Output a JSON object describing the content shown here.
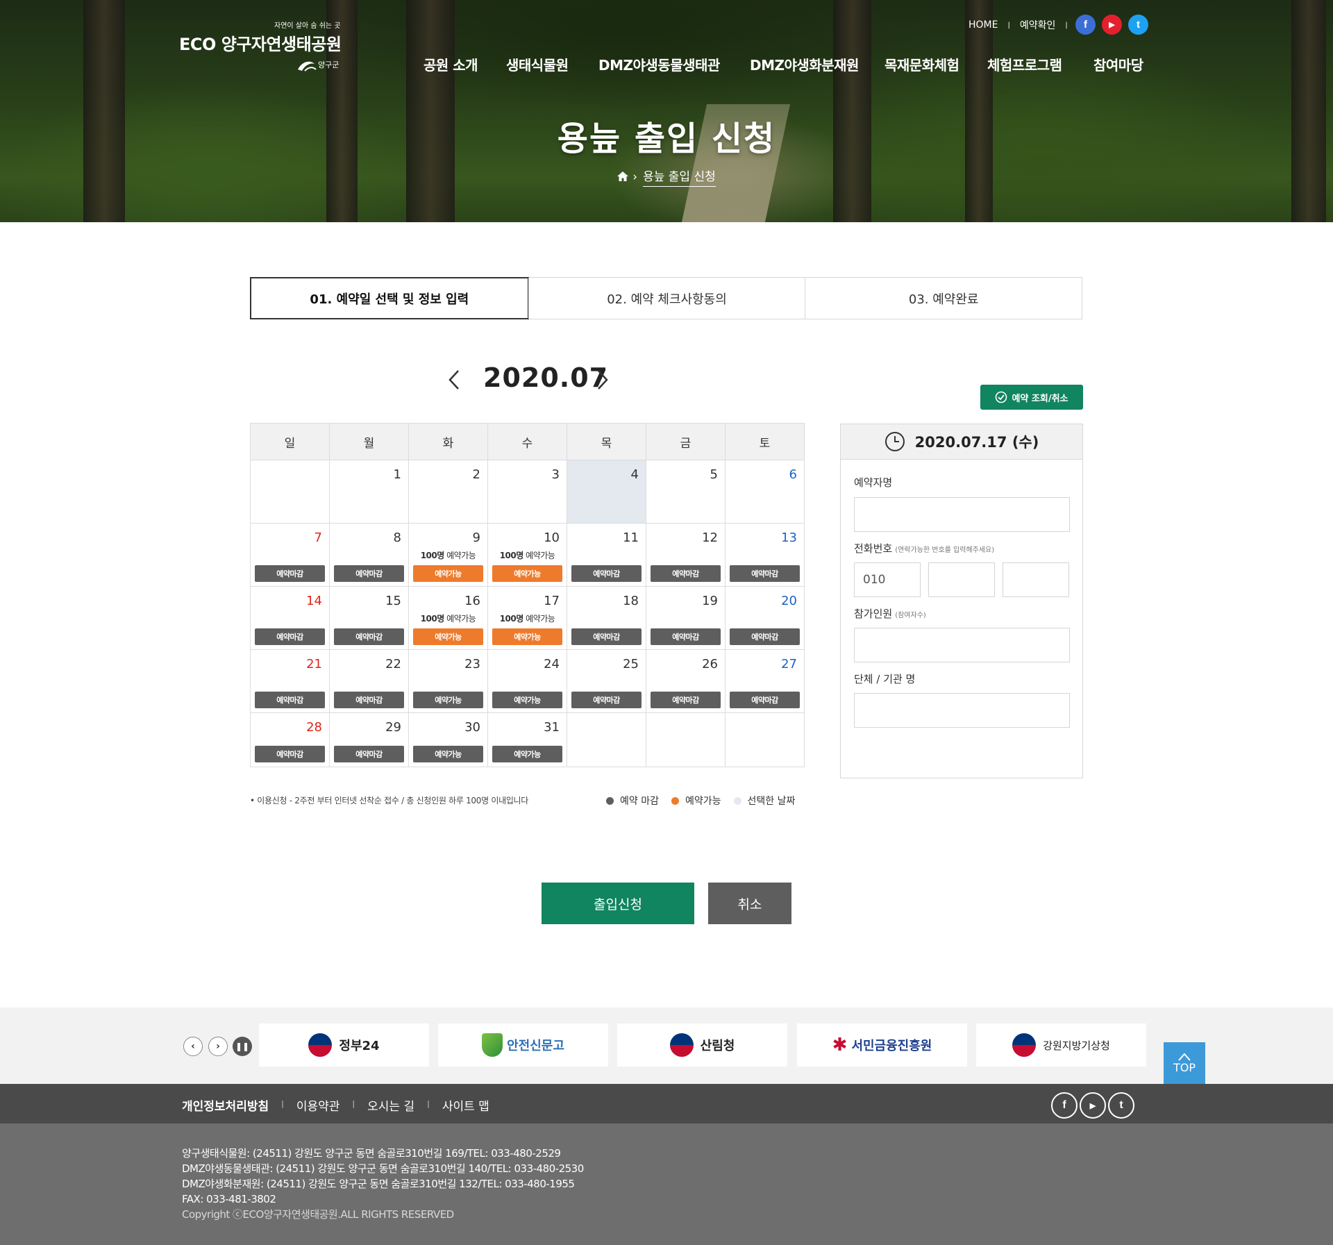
{
  "header": {
    "tagline": "자연이 살아 숨 쉬는 곳",
    "site_name": "ECO 양구자연생태공원",
    "county_logo": "양구군",
    "util": [
      "HOME",
      "예약확인"
    ],
    "sns": [
      {
        "name": "facebook-icon",
        "glyph": "f",
        "color": "#3b6fd6"
      },
      {
        "name": "youtube-icon",
        "glyph": "▶",
        "color": "#e4202e"
      },
      {
        "name": "twitter-icon",
        "glyph": "t",
        "color": "#1da1f2"
      }
    ],
    "gnb": [
      "공원 소개",
      "생태식물원",
      "DMZ야생동물생태관",
      "DMZ야생화분재원",
      "목재문화체험",
      "체험프로그램",
      "참여마당"
    ]
  },
  "hero": {
    "title": "용늪 출입 신청",
    "breadcrumb": "용늪 출입 신청"
  },
  "steps": [
    "01. 예약일 선택 및 정보 입력",
    "02. 예약 체크사항동의",
    "03. 예약완료"
  ],
  "calendar": {
    "month_label": "2020.07",
    "lookup_button": "예약 조회/취소",
    "weekdays": [
      "일",
      "월",
      "화",
      "수",
      "목",
      "금",
      "토"
    ],
    "available_text": "100명 예약가능",
    "status_labels": {
      "closed": "예약마감",
      "open": "예약가능"
    },
    "weeks": [
      [
        null,
        {
          "d": "1"
        },
        {
          "d": "2"
        },
        {
          "d": "3"
        },
        {
          "d": "4",
          "selected": true
        },
        {
          "d": "5"
        },
        {
          "d": "6"
        }
      ],
      [
        {
          "d": "7",
          "s": "closed"
        },
        {
          "d": "8",
          "s": "closed"
        },
        {
          "d": "9",
          "s": "open",
          "avail": true
        },
        {
          "d": "10",
          "s": "open",
          "avail": true
        },
        {
          "d": "11",
          "s": "closed"
        },
        {
          "d": "12",
          "s": "closed"
        },
        {
          "d": "13",
          "s": "closed"
        }
      ],
      [
        {
          "d": "14",
          "s": "closed"
        },
        {
          "d": "15",
          "s": "closed"
        },
        {
          "d": "16",
          "s": "open",
          "avail": true
        },
        {
          "d": "17",
          "s": "open",
          "avail": true
        },
        {
          "d": "18",
          "s": "closed"
        },
        {
          "d": "19",
          "s": "closed"
        },
        {
          "d": "20",
          "s": "closed"
        }
      ],
      [
        {
          "d": "21",
          "s": "closed"
        },
        {
          "d": "22",
          "s": "closed"
        },
        {
          "d": "23",
          "s": "closed",
          "label": "open"
        },
        {
          "d": "24",
          "s": "closed",
          "label": "open"
        },
        {
          "d": "25",
          "s": "closed"
        },
        {
          "d": "26",
          "s": "closed"
        },
        {
          "d": "27",
          "s": "closed"
        }
      ],
      [
        {
          "d": "28",
          "s": "closed"
        },
        {
          "d": "29",
          "s": "closed"
        },
        {
          "d": "30",
          "s": "closed",
          "label": "open"
        },
        {
          "d": "31",
          "s": "closed",
          "label": "open"
        },
        null,
        null,
        null
      ]
    ],
    "notice": "• 이용신청 - 2주전 부터 인터넷 선착순 접수 / 총 신청인원 하루 100명 이내입니다",
    "legend": [
      {
        "label": "예약 마감",
        "color": "#5e5e5e"
      },
      {
        "label": "예약가능",
        "color": "#ee7b2c"
      },
      {
        "label": "선택한 날짜",
        "color": "#e3e9ee"
      }
    ]
  },
  "form": {
    "selected_date": "2020.07.17 (수)",
    "name_label": "예약자명",
    "phone_label": "전화번호",
    "phone_hint": "(연락가능한 번호를 입력해주세요)",
    "phone_prefix": "010",
    "people_label": "참가인원",
    "people_hint": "(참여자수)",
    "org_label": "단체 / 기관 명"
  },
  "actions": {
    "submit": "출입신청",
    "cancel": "취소"
  },
  "banners": [
    "정부24",
    "안전신문고",
    "산림청",
    "서민금융진흥원",
    "강원지방기상청"
  ],
  "top_label": "TOP",
  "footer": {
    "links": [
      "개인정보처리방침",
      "이용약관",
      "오시는 길",
      "사이트 맵"
    ],
    "lines": [
      "양구생태식물원: (24511) 강원도 양구군 동면 숨골로310번길 169/TEL: 033-480-2529",
      "DMZ야생동물생태관: (24511) 강원도 양구군 동면 숨골로310번길 140/TEL: 033-480-2530",
      "DMZ야생화분재원: (24511) 강원도 양구군 동면 숨골로310번길 132/TEL: 033-480-1955",
      "FAX: 033-481-3802"
    ],
    "copyright": "Copyright ⓒECO양구자연생태공원.ALL RIGHTS RESERVED"
  }
}
